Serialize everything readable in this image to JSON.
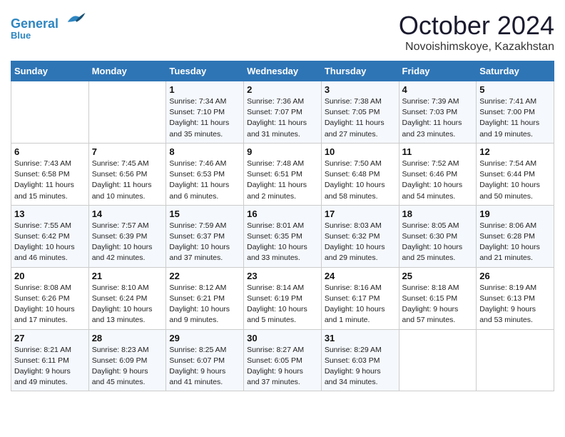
{
  "header": {
    "logo_line1": "General",
    "logo_line2": "Blue",
    "month": "October 2024",
    "location": "Novoishimskoye, Kazakhstan"
  },
  "weekdays": [
    "Sunday",
    "Monday",
    "Tuesday",
    "Wednesday",
    "Thursday",
    "Friday",
    "Saturday"
  ],
  "weeks": [
    [
      {
        "day": "",
        "info": ""
      },
      {
        "day": "",
        "info": ""
      },
      {
        "day": "1",
        "info": "Sunrise: 7:34 AM\nSunset: 7:10 PM\nDaylight: 11 hours\nand 35 minutes."
      },
      {
        "day": "2",
        "info": "Sunrise: 7:36 AM\nSunset: 7:07 PM\nDaylight: 11 hours\nand 31 minutes."
      },
      {
        "day": "3",
        "info": "Sunrise: 7:38 AM\nSunset: 7:05 PM\nDaylight: 11 hours\nand 27 minutes."
      },
      {
        "day": "4",
        "info": "Sunrise: 7:39 AM\nSunset: 7:03 PM\nDaylight: 11 hours\nand 23 minutes."
      },
      {
        "day": "5",
        "info": "Sunrise: 7:41 AM\nSunset: 7:00 PM\nDaylight: 11 hours\nand 19 minutes."
      }
    ],
    [
      {
        "day": "6",
        "info": "Sunrise: 7:43 AM\nSunset: 6:58 PM\nDaylight: 11 hours\nand 15 minutes."
      },
      {
        "day": "7",
        "info": "Sunrise: 7:45 AM\nSunset: 6:56 PM\nDaylight: 11 hours\nand 10 minutes."
      },
      {
        "day": "8",
        "info": "Sunrise: 7:46 AM\nSunset: 6:53 PM\nDaylight: 11 hours\nand 6 minutes."
      },
      {
        "day": "9",
        "info": "Sunrise: 7:48 AM\nSunset: 6:51 PM\nDaylight: 11 hours\nand 2 minutes."
      },
      {
        "day": "10",
        "info": "Sunrise: 7:50 AM\nSunset: 6:48 PM\nDaylight: 10 hours\nand 58 minutes."
      },
      {
        "day": "11",
        "info": "Sunrise: 7:52 AM\nSunset: 6:46 PM\nDaylight: 10 hours\nand 54 minutes."
      },
      {
        "day": "12",
        "info": "Sunrise: 7:54 AM\nSunset: 6:44 PM\nDaylight: 10 hours\nand 50 minutes."
      }
    ],
    [
      {
        "day": "13",
        "info": "Sunrise: 7:55 AM\nSunset: 6:42 PM\nDaylight: 10 hours\nand 46 minutes."
      },
      {
        "day": "14",
        "info": "Sunrise: 7:57 AM\nSunset: 6:39 PM\nDaylight: 10 hours\nand 42 minutes."
      },
      {
        "day": "15",
        "info": "Sunrise: 7:59 AM\nSunset: 6:37 PM\nDaylight: 10 hours\nand 37 minutes."
      },
      {
        "day": "16",
        "info": "Sunrise: 8:01 AM\nSunset: 6:35 PM\nDaylight: 10 hours\nand 33 minutes."
      },
      {
        "day": "17",
        "info": "Sunrise: 8:03 AM\nSunset: 6:32 PM\nDaylight: 10 hours\nand 29 minutes."
      },
      {
        "day": "18",
        "info": "Sunrise: 8:05 AM\nSunset: 6:30 PM\nDaylight: 10 hours\nand 25 minutes."
      },
      {
        "day": "19",
        "info": "Sunrise: 8:06 AM\nSunset: 6:28 PM\nDaylight: 10 hours\nand 21 minutes."
      }
    ],
    [
      {
        "day": "20",
        "info": "Sunrise: 8:08 AM\nSunset: 6:26 PM\nDaylight: 10 hours\nand 17 minutes."
      },
      {
        "day": "21",
        "info": "Sunrise: 8:10 AM\nSunset: 6:24 PM\nDaylight: 10 hours\nand 13 minutes."
      },
      {
        "day": "22",
        "info": "Sunrise: 8:12 AM\nSunset: 6:21 PM\nDaylight: 10 hours\nand 9 minutes."
      },
      {
        "day": "23",
        "info": "Sunrise: 8:14 AM\nSunset: 6:19 PM\nDaylight: 10 hours\nand 5 minutes."
      },
      {
        "day": "24",
        "info": "Sunrise: 8:16 AM\nSunset: 6:17 PM\nDaylight: 10 hours\nand 1 minute."
      },
      {
        "day": "25",
        "info": "Sunrise: 8:18 AM\nSunset: 6:15 PM\nDaylight: 9 hours\nand 57 minutes."
      },
      {
        "day": "26",
        "info": "Sunrise: 8:19 AM\nSunset: 6:13 PM\nDaylight: 9 hours\nand 53 minutes."
      }
    ],
    [
      {
        "day": "27",
        "info": "Sunrise: 8:21 AM\nSunset: 6:11 PM\nDaylight: 9 hours\nand 49 minutes."
      },
      {
        "day": "28",
        "info": "Sunrise: 8:23 AM\nSunset: 6:09 PM\nDaylight: 9 hours\nand 45 minutes."
      },
      {
        "day": "29",
        "info": "Sunrise: 8:25 AM\nSunset: 6:07 PM\nDaylight: 9 hours\nand 41 minutes."
      },
      {
        "day": "30",
        "info": "Sunrise: 8:27 AM\nSunset: 6:05 PM\nDaylight: 9 hours\nand 37 minutes."
      },
      {
        "day": "31",
        "info": "Sunrise: 8:29 AM\nSunset: 6:03 PM\nDaylight: 9 hours\nand 34 minutes."
      },
      {
        "day": "",
        "info": ""
      },
      {
        "day": "",
        "info": ""
      }
    ]
  ]
}
